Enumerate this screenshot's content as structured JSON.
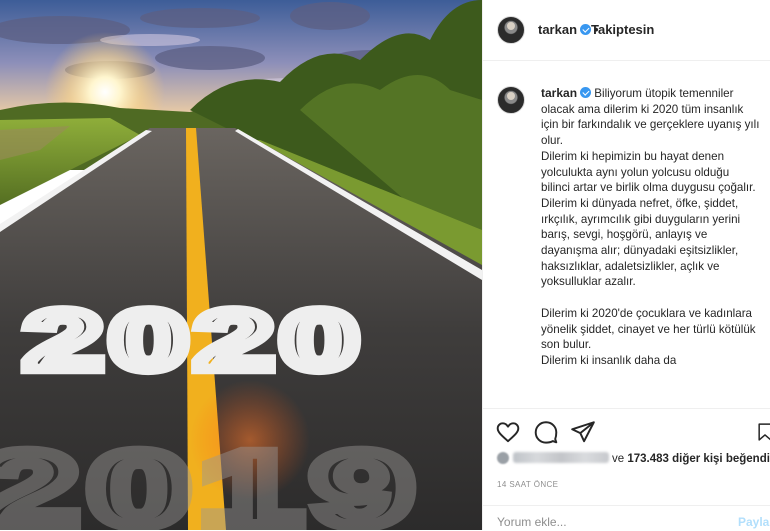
{
  "photo": {
    "road_text_current": "2020",
    "road_text_previous": "2019"
  },
  "header": {
    "username": "tarkan",
    "separator": "•",
    "follow_status": "Takiptesin"
  },
  "caption": {
    "username": "tarkan",
    "lines": [
      "Biliyorum ütopik temenniler olacak ama dilerim ki 2020 tüm insanlık için bir farkındalık ve gerçeklere uyanış yılı olur.",
      "Dilerim ki hepimizin bu hayat denen yolculukta aynı yolun yolcusu olduğu bilinci artar ve birlik olma duygusu çoğalır.",
      "Dilerim ki dünyada nefret, öfke, şiddet, ırkçılık, ayrımcılık gibi duyguların yerini barış, sevgi, hoşgörü, anlayış ve dayanışma alır; dünyadaki eşitsizlikler, haksızlıklar, adaletsizlikler, açlık ve yoksulluklar azalır.",
      "",
      "Dilerim ki 2020'de çocuklara ve kadınlara yönelik şiddet, cinayet ve her türlü kötülük son bulur.",
      "Dilerim ki insanlık daha da"
    ]
  },
  "actions": {
    "like_icon": "heart-icon",
    "comment_icon": "comment-icon",
    "share_icon": "paper-plane-icon",
    "save_icon": "bookmark-icon"
  },
  "likes": {
    "connector": "ve",
    "count_text": "173.483 diğer kişi",
    "suffix": "beğendi"
  },
  "timestamp": "14 SAAT ÖNCE",
  "comment": {
    "placeholder": "Yorum ekle...",
    "post_label": "Paylaş"
  },
  "colors": {
    "verified_blue": "#3897f0",
    "muted_text": "#8e8e8e",
    "post_disabled": "#b2dffc"
  }
}
